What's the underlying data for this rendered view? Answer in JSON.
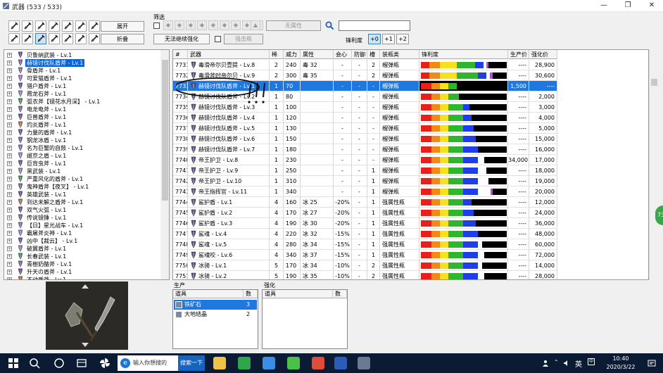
{
  "window": {
    "title": "武器 (533 / 533)"
  },
  "toolbar": {
    "expand_label": "展开",
    "collapse_label": "折叠",
    "filter_label": "筛选",
    "no_attr_label": "无属性",
    "no_upgrade_label": "无法继续强化",
    "slot_label": "强击瓶",
    "sharpness_label": "锋利度",
    "sharp_plus": [
      "+0",
      "+1",
      "+2"
    ]
  },
  "tree": {
    "items": [
      {
        "label": "贝鲁纳武装 - Lv.1"
      },
      {
        "label": "赫镜讨伐队盾斧 - Lv.1",
        "selected": true
      },
      {
        "label": "骨盾斧 - Lv.1"
      },
      {
        "label": "可爱猫盾斧 - Lv.1"
      },
      {
        "label": "猎户盾斧 - Lv.1"
      },
      {
        "label": "霞龙石斧 - Lv.1"
      },
      {
        "label": "弧衣斧【镜花水月深】 - Lv.1"
      },
      {
        "label": "电龙电斧 - Lv.1"
      },
      {
        "label": "巨兽盾斧 - Lv.1"
      },
      {
        "label": "灼炎盾斧 - Lv.1"
      },
      {
        "label": "力量的盾斧 - Lv.1"
      },
      {
        "label": "钢龙冰盾 - Lv.1"
      },
      {
        "label": "名为巨蟹的自鼓 - Lv.1"
      },
      {
        "label": "雌京之盾 - Lv.1"
      },
      {
        "label": "巨背虫斧 - Lv.1"
      },
      {
        "label": "黑武装 - Lv.1"
      },
      {
        "label": "严重风化的盾斧 - Lv.1"
      },
      {
        "label": "鬼神盾斧【夜叉】 - Lv.1"
      },
      {
        "label": "英雄武装 - Lv.1"
      },
      {
        "label": "到达未解之盾斧 - Lv.1"
      },
      {
        "label": "双气火弧 - Lv.1"
      },
      {
        "label": "传说镜锤 - Lv.1"
      },
      {
        "label": "【日】星光战车 - Lv.1"
      },
      {
        "label": "霸屠斧炎神 - Lv.1"
      },
      {
        "label": "凶中【裁云】 - Lv.1"
      },
      {
        "label": "破翼盾斧 - Lv.1"
      },
      {
        "label": "长春武装 - Lv.1"
      },
      {
        "label": "青樹奶酪斧 - Lv.1"
      },
      {
        "label": "升天の盾斧 - Lv.1"
      },
      {
        "label": "不动盾斧 - Lv.1"
      }
    ]
  },
  "grid": {
    "headers": [
      "#",
      "武器",
      "稀",
      "威力",
      "属性",
      "会心",
      "防御",
      "槽",
      "装瓶类",
      "锋利度",
      "生产价",
      "强化价"
    ],
    "rows": [
      {
        "id": "7731",
        "name": "毒滑帝尔贝壹提 - Lv.8",
        "rare": "2",
        "atk": "240",
        "attr": "毒 32",
        "aff": "-",
        "def": "-",
        "slot": "2",
        "phial": "榴弹瓶",
        "sharp": [
          8,
          10,
          16,
          17,
          8,
          3,
          2
        ],
        "make": "----",
        "up": "28,900"
      },
      {
        "id": "7732",
        "name": "毒滑斧时帝尔贝 - Lv.9",
        "rare": "2",
        "atk": "300",
        "attr": "毒 35",
        "aff": "-",
        "def": "-",
        "slot": "2",
        "phial": "榴弹瓶",
        "sharp": [
          8,
          10,
          16,
          20,
          8,
          3,
          3
        ],
        "make": "----",
        "up": "30,600"
      },
      {
        "id": "7733",
        "name": "赫镜讨伐队盾斧 - Lv.1",
        "rare": "1",
        "atk": "70",
        "attr": "",
        "aff": "-",
        "def": "-",
        "slot": "-",
        "phial": "榴弹瓶",
        "sharp": [
          10,
          8,
          8,
          8,
          0,
          0,
          0
        ],
        "make": "1,500",
        "up": "----",
        "selected": true
      },
      {
        "id": "7734",
        "name": "赫镜讨伐队盾斧 - Lv.2",
        "rare": "1",
        "atk": "80",
        "attr": "",
        "aff": "-",
        "def": "-",
        "slot": "-",
        "phial": "榴弹瓶",
        "sharp": [
          10,
          8,
          8,
          10,
          0,
          0,
          0
        ],
        "make": "----",
        "up": "2,000"
      },
      {
        "id": "7735",
        "name": "赫镜讨伐队盾斧 - Lv.3",
        "rare": "1",
        "atk": "100",
        "attr": "",
        "aff": "-",
        "def": "-",
        "slot": "-",
        "phial": "榴弹瓶",
        "sharp": [
          10,
          8,
          8,
          14,
          6,
          0,
          0
        ],
        "make": "----",
        "up": "3,000"
      },
      {
        "id": "7736",
        "name": "赫镜讨伐队盾斧 - Lv.4",
        "rare": "1",
        "atk": "120",
        "attr": "",
        "aff": "-",
        "def": "-",
        "slot": "-",
        "phial": "榴弹瓶",
        "sharp": [
          10,
          8,
          8,
          14,
          8,
          0,
          0
        ],
        "make": "----",
        "up": "4,000"
      },
      {
        "id": "7737",
        "name": "赫镜讨伐队盾斧 - Lv.5",
        "rare": "1",
        "atk": "130",
        "attr": "",
        "aff": "-",
        "def": "-",
        "slot": "-",
        "phial": "榴弹瓶",
        "sharp": [
          10,
          8,
          8,
          14,
          10,
          0,
          0
        ],
        "make": "----",
        "up": "5,000"
      },
      {
        "id": "7738",
        "name": "赫镜讨伐队盾斧 - Lv.6",
        "rare": "1",
        "atk": "150",
        "attr": "",
        "aff": "-",
        "def": "-",
        "slot": "-",
        "phial": "榴弹瓶",
        "sharp": [
          10,
          8,
          8,
          14,
          12,
          0,
          0
        ],
        "make": "----",
        "up": "15,000"
      },
      {
        "id": "7739",
        "name": "赫镜讨伐队盾斧 - Lv.7",
        "rare": "1",
        "atk": "180",
        "attr": "",
        "aff": "-",
        "def": "-",
        "slot": "-",
        "phial": "榴弹瓶",
        "sharp": [
          10,
          8,
          8,
          14,
          14,
          0,
          0
        ],
        "make": "----",
        "up": "16,000"
      },
      {
        "id": "7740",
        "name": "帝王护卫 - Lv.8",
        "rare": "1",
        "atk": "230",
        "attr": "",
        "aff": "-",
        "def": "-",
        "slot": "-",
        "phial": "榴弹瓶",
        "sharp": [
          10,
          8,
          8,
          14,
          14,
          6,
          0
        ],
        "make": "34,000",
        "up": "17,000"
      },
      {
        "id": "7741",
        "name": "帝王护卫 - Lv.9",
        "rare": "1",
        "atk": "250",
        "attr": "",
        "aff": "-",
        "def": "-",
        "slot": "1",
        "phial": "榴弹瓶",
        "sharp": [
          10,
          8,
          8,
          14,
          14,
          8,
          0
        ],
        "make": "----",
        "up": "18,000"
      },
      {
        "id": "7742",
        "name": "帝王护卫 - Lv.10",
        "rare": "1",
        "atk": "310",
        "attr": "",
        "aff": "-",
        "def": "-",
        "slot": "1",
        "phial": "榴弹瓶",
        "sharp": [
          10,
          8,
          8,
          14,
          14,
          10,
          0
        ],
        "make": "----",
        "up": "19,000"
      },
      {
        "id": "7743",
        "name": "帝王指挥官 - Lv.11",
        "rare": "1",
        "atk": "340",
        "attr": "",
        "aff": "-",
        "def": "-",
        "slot": "1",
        "phial": "榴弹瓶",
        "sharp": [
          10,
          8,
          8,
          14,
          14,
          12,
          2
        ],
        "make": "----",
        "up": "20,000"
      },
      {
        "id": "7744",
        "name": "鲨护盾 - Lv.1",
        "rare": "4",
        "atk": "160",
        "attr": "冰 25",
        "aff": "-20%",
        "def": "-",
        "slot": "1",
        "phial": "强属性瓶",
        "sharp": [
          10,
          8,
          8,
          14,
          8,
          0,
          0
        ],
        "make": "----",
        "up": "12,000"
      },
      {
        "id": "7745",
        "name": "鲨护盾 - Lv.2",
        "rare": "4",
        "atk": "170",
        "attr": "冰 27",
        "aff": "-20%",
        "def": "-",
        "slot": "1",
        "phial": "强属性瓶",
        "sharp": [
          10,
          8,
          8,
          14,
          10,
          0,
          0
        ],
        "make": "----",
        "up": "24,000"
      },
      {
        "id": "7746",
        "name": "鲨护盾 - Lv.3",
        "rare": "4",
        "atk": "190",
        "attr": "冰 30",
        "aff": "-20%",
        "def": "-",
        "slot": "1",
        "phial": "强属性瓶",
        "sharp": [
          10,
          8,
          8,
          14,
          12,
          0,
          0
        ],
        "make": "----",
        "up": "36,000"
      },
      {
        "id": "7747",
        "name": "鲨魂 - Lv.4",
        "rare": "4",
        "atk": "220",
        "attr": "冰 32",
        "aff": "-15%",
        "def": "-",
        "slot": "1",
        "phial": "强属性瓶",
        "sharp": [
          10,
          8,
          8,
          14,
          14,
          0,
          0
        ],
        "make": "----",
        "up": "48,000"
      },
      {
        "id": "7748",
        "name": "鲨魂 - Lv.5",
        "rare": "4",
        "atk": "280",
        "attr": "冰 34",
        "aff": "-15%",
        "def": "-",
        "slot": "1",
        "phial": "强属性瓶",
        "sharp": [
          10,
          8,
          8,
          14,
          14,
          4,
          0
        ],
        "make": "----",
        "up": "60,000"
      },
      {
        "id": "7749",
        "name": "鲨魂咬 - Lv.6",
        "rare": "4",
        "atk": "340",
        "attr": "冰 37",
        "aff": "-15%",
        "def": "-",
        "slot": "1",
        "phial": "强属性瓶",
        "sharp": [
          10,
          8,
          8,
          14,
          14,
          6,
          0
        ],
        "make": "----",
        "up": "72,000"
      },
      {
        "id": "7750",
        "name": "冰骑 - Lv.1",
        "rare": "5",
        "atk": "170",
        "attr": "冰 34",
        "aff": "-10%",
        "def": "-",
        "slot": "2",
        "phial": "强属性瓶",
        "sharp": [
          10,
          8,
          8,
          14,
          14,
          4,
          0
        ],
        "make": "----",
        "up": "14,000"
      },
      {
        "id": "7751",
        "name": "冰骑 - Lv.2",
        "rare": "5",
        "atk": "190",
        "attr": "冰 35",
        "aff": "-10%",
        "def": "-",
        "slot": "2",
        "phial": "强属性瓶",
        "sharp": [
          10,
          8,
          8,
          14,
          14,
          6,
          0
        ],
        "make": "----",
        "up": "28,000"
      }
    ]
  },
  "production": {
    "label": "生产",
    "header_item": "道具",
    "header_qty": "数",
    "rows": [
      {
        "item": "铁矿石",
        "qty": "3",
        "selected": true
      },
      {
        "item": "大地结晶",
        "qty": "2"
      }
    ]
  },
  "upgrade": {
    "label": "强化",
    "header_item": "道具",
    "header_qty": "数"
  },
  "taskbar": {
    "search_placeholder": "输入你想搜的",
    "search_button": "搜索一下",
    "time": "10:40",
    "date": "2020/3/22",
    "ime": "英"
  },
  "bubble": {
    "text": "73"
  },
  "colors": {
    "select_blue": "#0a64d8",
    "grid_select": "#1f78e2",
    "sharp_red": "#e8201c",
    "sharp_orange": "#f08a14",
    "sharp_yellow": "#f4e21a",
    "sharp_green": "#2fb52e",
    "sharp_blue": "#1e3fe8",
    "sharp_white": "#ffffff",
    "sharp_purple": "#b04ce0"
  }
}
